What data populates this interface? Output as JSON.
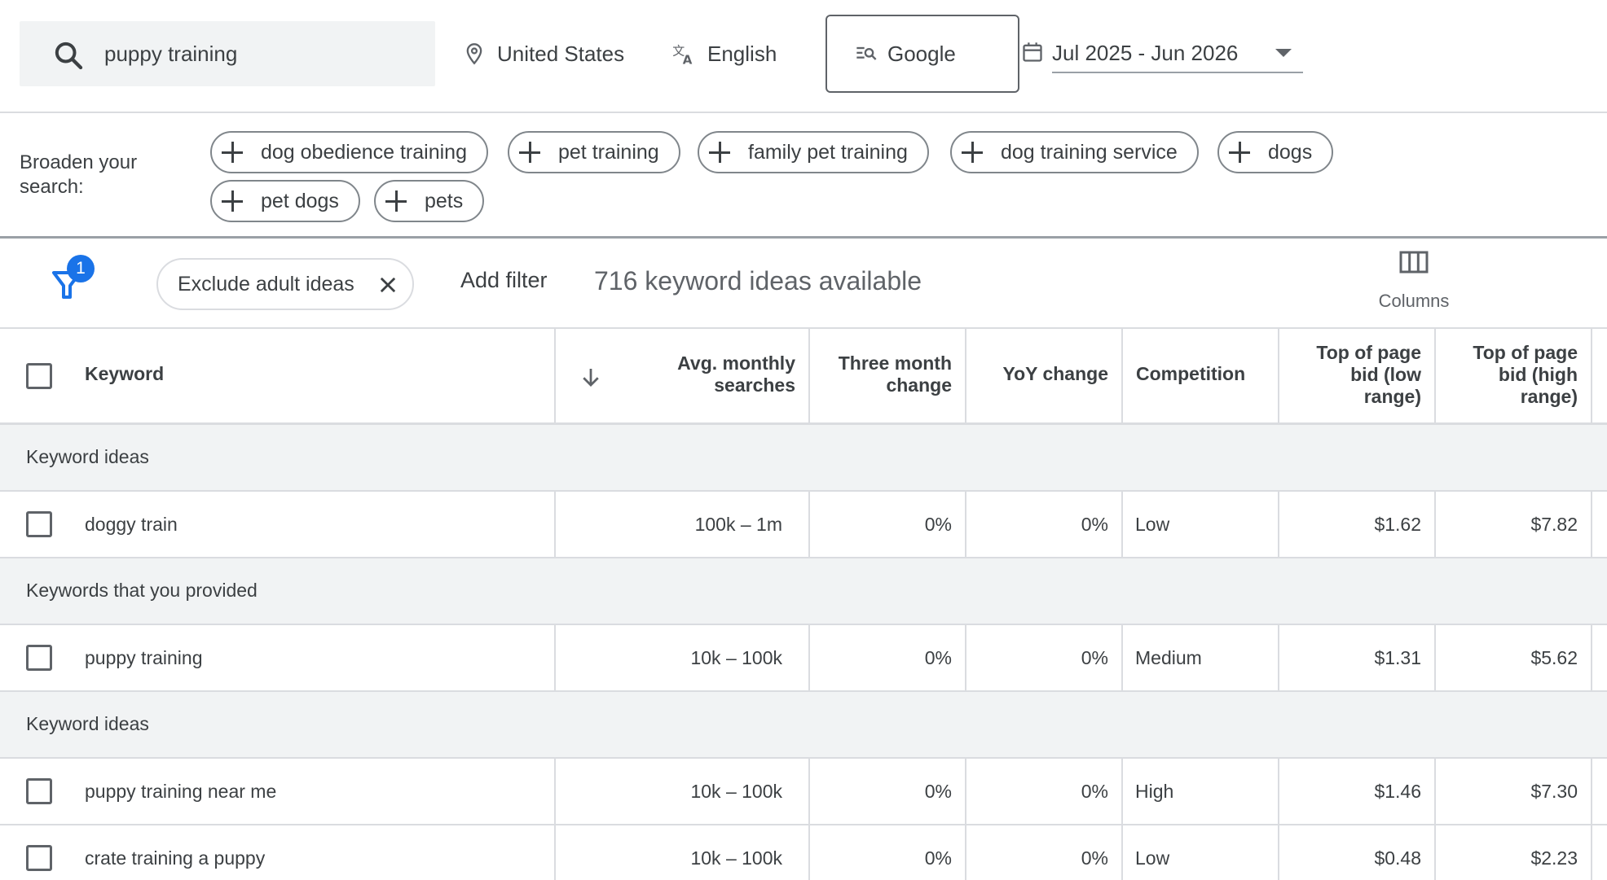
{
  "search": {
    "query": "puppy training"
  },
  "location": {
    "label": "United States"
  },
  "language": {
    "label": "English"
  },
  "network": {
    "label": "Google"
  },
  "date_range": {
    "label": "Jul 2025 - Jun 2026"
  },
  "broaden": {
    "label": "Broaden your search:",
    "chips": [
      "dog obedience training",
      "pet training",
      "family pet training",
      "dog training service",
      "dogs",
      "pet dogs",
      "pets"
    ]
  },
  "filters": {
    "active_count": "1",
    "chip_label": "Exclude adult ideas",
    "add_filter_label": "Add filter",
    "ideas_available": "716 keyword ideas available",
    "columns_label": "Columns"
  },
  "table": {
    "headers": {
      "keyword": "Keyword",
      "avg_monthly": "Avg. monthly searches",
      "three_month": "Three month change",
      "yoy": "YoY change",
      "competition": "Competition",
      "bid_low": "Top of page bid (low range)",
      "bid_high": "Top of page bid (high range)"
    },
    "groups": [
      {
        "label": "Keyword ideas",
        "rows": [
          {
            "keyword": "doggy train",
            "avg": "100k – 1m",
            "three_month": "0%",
            "yoy": "0%",
            "competition": "Low",
            "bid_low": "$1.62",
            "bid_high": "$7.82"
          }
        ]
      },
      {
        "label": "Keywords that you provided",
        "rows": [
          {
            "keyword": "puppy training",
            "avg": "10k – 100k",
            "three_month": "0%",
            "yoy": "0%",
            "competition": "Medium",
            "bid_low": "$1.31",
            "bid_high": "$5.62"
          }
        ]
      },
      {
        "label": "Keyword ideas",
        "rows": [
          {
            "keyword": "puppy training near me",
            "avg": "10k – 100k",
            "three_month": "0%",
            "yoy": "0%",
            "competition": "High",
            "bid_low": "$1.46",
            "bid_high": "$7.30"
          },
          {
            "keyword": "crate training a puppy",
            "avg": "10k – 100k",
            "three_month": "0%",
            "yoy": "0%",
            "competition": "Low",
            "bid_low": "$0.48",
            "bid_high": "$2.23"
          }
        ]
      }
    ]
  },
  "colors": {
    "accent": "#1a73e8",
    "divider": "#dadce0",
    "group_bg": "#f1f3f4",
    "text": "#3c4043"
  }
}
